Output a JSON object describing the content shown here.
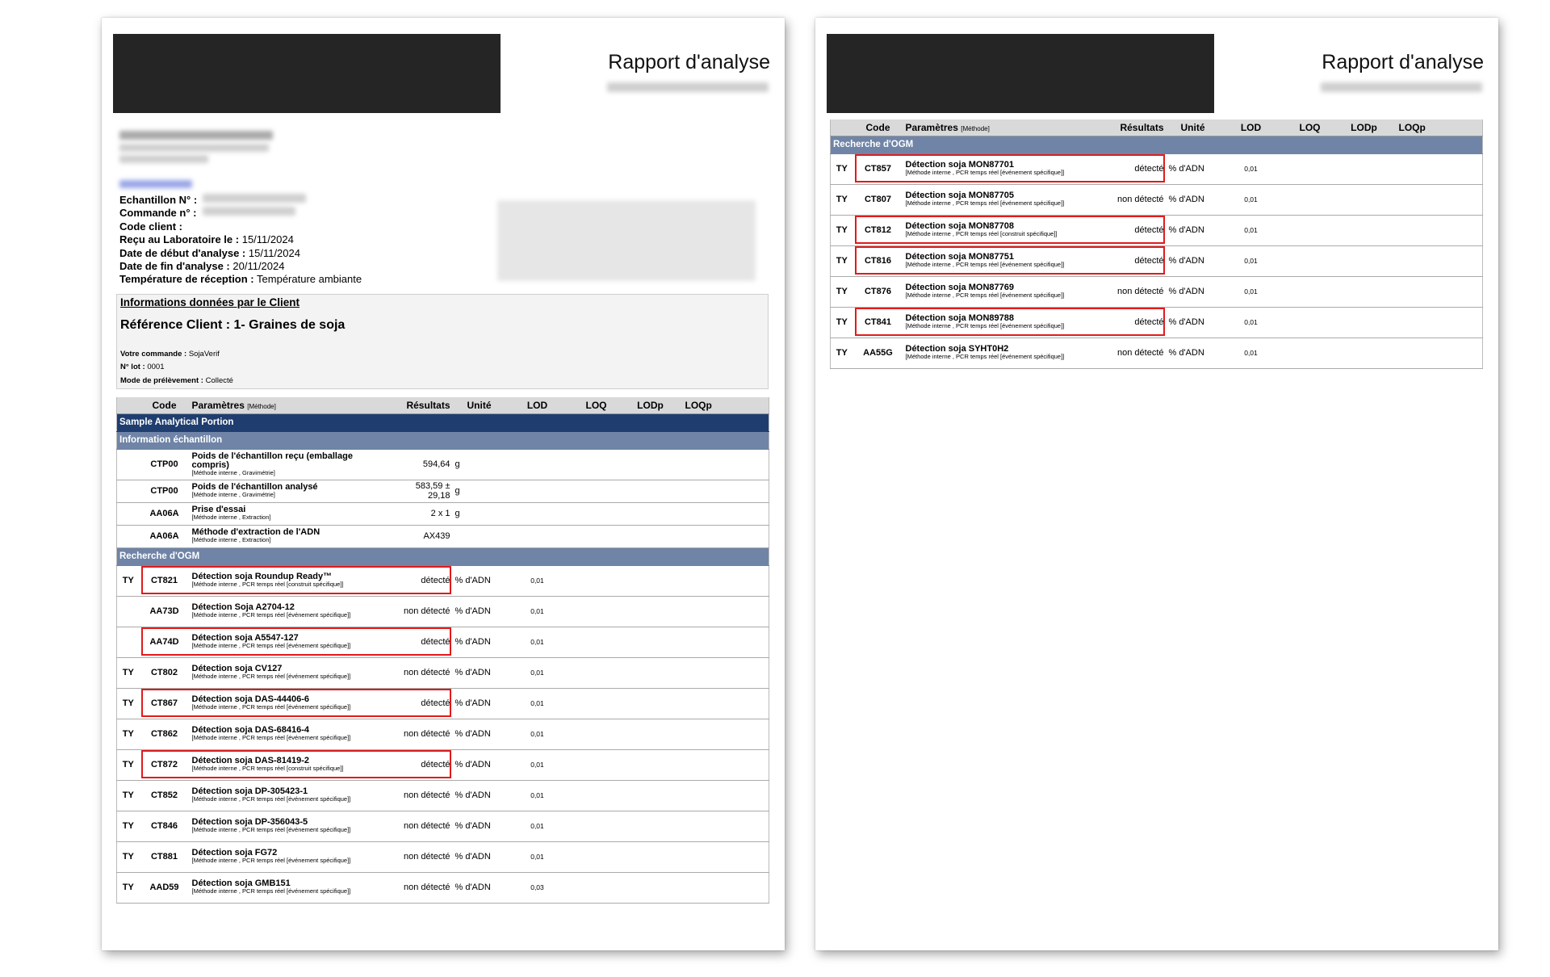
{
  "header": {
    "title": "Rapport d'analyse"
  },
  "sample_info": {
    "echantillon_label": "Echantillon N° :",
    "commande_label": "Commande n° :",
    "code_client_label": "Code client :",
    "recu_label": "Reçu au Laboratoire le :",
    "recu_value": "15/11/2024",
    "debut_label": "Date de début d'analyse :",
    "debut_value": "15/11/2024",
    "fin_label": "Date de fin d'analyse :",
    "fin_value": "20/11/2024",
    "temp_label": "Température de réception :",
    "temp_value": "Température ambiante"
  },
  "client": {
    "heading": "Informations données par le Client",
    "reference": "Référence Client : 1- Graines de soja",
    "commande_label": "Votre commande :",
    "commande_value": "SojaVerif",
    "lot_label": "N° lot :",
    "lot_value": "0001",
    "mode_label": "Mode de prélèvement :",
    "mode_value": "Collecté"
  },
  "table_headers": {
    "code": "Code",
    "parametres": "Paramètres",
    "methode": "[Méthode]",
    "resultats": "Résultats",
    "unite": "Unité",
    "lod": "LOD",
    "loq": "LOQ",
    "lodp": "LODp",
    "loqp": "LOQp"
  },
  "page1": {
    "section": "Sample Analytical Portion",
    "sub_info": "Information échantillon",
    "sub_ogm": "Recherche d'OGM",
    "info_rows": [
      {
        "code": "CTP00",
        "name": "Poids de l'échantillon reçu (emballage compris)",
        "method": "[Méthode interne , Gravimétrie]",
        "result": "594,64",
        "unit": "g"
      },
      {
        "code": "CTP00",
        "name": "Poids de l'échantillon analysé",
        "method": "[Méthode interne , Gravimétrie]",
        "result": "583,59 ± 29,18",
        "unit": "g"
      },
      {
        "code": "AA06A",
        "name": "Prise d'essai",
        "method": "[Méthode interne , Extraction]",
        "result": "2 x 1",
        "unit": "g"
      },
      {
        "code": "AA06A",
        "name": "Méthode d'extraction de l'ADN",
        "method": "[Méthode interne , Extraction]",
        "result": "AX439",
        "unit": ""
      }
    ],
    "ogm_rows": [
      {
        "ty": "TY",
        "code": "CT821",
        "name": "Détection soja Roundup Ready™",
        "method": "[Méthode interne , PCR temps réel [construit spécifique]]",
        "result": "détecté",
        "unit": "% d'ADN",
        "lod": "0,01"
      },
      {
        "ty": "",
        "code": "AA73D",
        "name": "Détection Soja A2704-12",
        "method": "[Méthode interne , PCR temps réel [événement spécifique]]",
        "result": "non détecté",
        "unit": "% d'ADN",
        "lod": "0,01"
      },
      {
        "ty": "",
        "code": "AA74D",
        "name": "Détection soja A5547-127",
        "method": "[Méthode interne , PCR temps réel [événement spécifique]]",
        "result": "détecté",
        "unit": "% d'ADN",
        "lod": "0,01"
      },
      {
        "ty": "TY",
        "code": "CT802",
        "name": "Détection soja CV127",
        "method": "[Méthode interne , PCR temps réel [événement spécifique]]",
        "result": "non détecté",
        "unit": "% d'ADN",
        "lod": "0,01"
      },
      {
        "ty": "TY",
        "code": "CT867",
        "name": "Détection soja DAS-44406-6",
        "method": "[Méthode interne , PCR temps réel [événement spécifique]]",
        "result": "détecté",
        "unit": "% d'ADN",
        "lod": "0,01"
      },
      {
        "ty": "TY",
        "code": "CT862",
        "name": "Détection soja DAS-68416-4",
        "method": "[Méthode interne , PCR temps réel [événement spécifique]]",
        "result": "non détecté",
        "unit": "% d'ADN",
        "lod": "0,01"
      },
      {
        "ty": "TY",
        "code": "CT872",
        "name": "Détection soja DAS-81419-2",
        "method": "[Méthode interne , PCR temps réel [construit spécifique]]",
        "result": "détecté",
        "unit": "% d'ADN",
        "lod": "0,01"
      },
      {
        "ty": "TY",
        "code": "CT852",
        "name": "Détection soja DP-305423-1",
        "method": "[Méthode interne , PCR temps réel [événement spécifique]]",
        "result": "non détecté",
        "unit": "% d'ADN",
        "lod": "0,01"
      },
      {
        "ty": "TY",
        "code": "CT846",
        "name": "Détection soja DP-356043-5",
        "method": "[Méthode interne , PCR temps réel [événement spécifique]]",
        "result": "non détecté",
        "unit": "% d'ADN",
        "lod": "0,01"
      },
      {
        "ty": "TY",
        "code": "CT881",
        "name": "Détection soja FG72",
        "method": "[Méthode interne , PCR temps réel [événement spécifique]]",
        "result": "non détecté",
        "unit": "% d'ADN",
        "lod": "0,01"
      },
      {
        "ty": "TY",
        "code": "AAD59",
        "name": "Détection soja GMB151",
        "method": "[Méthode interne , PCR temps réel [événement spécifique]]",
        "result": "non détecté",
        "unit": "% d'ADN",
        "lod": "0,03"
      }
    ]
  },
  "page2": {
    "sub_ogm": "Recherche d'OGM",
    "ogm_rows": [
      {
        "ty": "TY",
        "code": "CT857",
        "name": "Détection soja MON87701",
        "method": "[Méthode interne , PCR temps réel [événement spécifique]]",
        "result": "détecté",
        "unit": "% d'ADN",
        "lod": "0,01"
      },
      {
        "ty": "TY",
        "code": "CT807",
        "name": "Détection soja MON87705",
        "method": "[Méthode interne , PCR temps réel [événement spécifique]]",
        "result": "non détecté",
        "unit": "% d'ADN",
        "lod": "0,01"
      },
      {
        "ty": "TY",
        "code": "CT812",
        "name": "Détection soja MON87708",
        "method": "[Méthode interne , PCR temps réel [construit spécifique]]",
        "result": "détecté",
        "unit": "% d'ADN",
        "lod": "0,01"
      },
      {
        "ty": "TY",
        "code": "CT816",
        "name": "Détection soja MON87751",
        "method": "[Méthode interne , PCR temps réel [événement spécifique]]",
        "result": "détecté",
        "unit": "% d'ADN",
        "lod": "0,01"
      },
      {
        "ty": "TY",
        "code": "CT876",
        "name": "Détection soja MON87769",
        "method": "[Méthode interne , PCR temps réel [événement spécifique]]",
        "result": "non détecté",
        "unit": "% d'ADN",
        "lod": "0,01"
      },
      {
        "ty": "TY",
        "code": "CT841",
        "name": "Détection soja MON89788",
        "method": "[Méthode interne , PCR temps réel [événement spécifique]]",
        "result": "détecté",
        "unit": "% d'ADN",
        "lod": "0,01"
      },
      {
        "ty": "TY",
        "code": "AA55G",
        "name": "Détection soja SYHT0H2",
        "method": "[Méthode interne , PCR temps réel [événement spécifique]]",
        "result": "non détecté",
        "unit": "% d'ADN",
        "lod": "0,01"
      }
    ]
  }
}
